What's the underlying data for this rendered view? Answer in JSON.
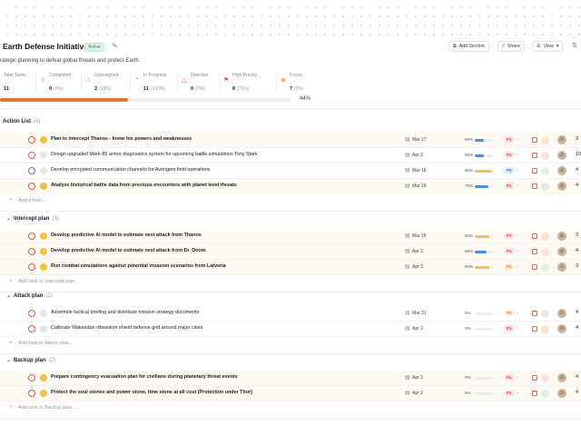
{
  "header": {
    "title": "Earth Defense Initiative",
    "status": "Active",
    "buttons": {
      "add_section": "Add Section",
      "share": "Share",
      "view": "View"
    }
  },
  "description": "rategic planning to defeat global threats and protect Earth.",
  "stats": [
    {
      "label": "Total Tasks",
      "value": "11",
      "pct": ""
    },
    {
      "label": "Completed",
      "value": "0",
      "pct": "(0%)"
    },
    {
      "label": "Unassigned",
      "value": "2",
      "pct": "(18%)"
    },
    {
      "label": "In Progress",
      "value": "11",
      "pct": "(100%)"
    },
    {
      "label": "Overdue",
      "value": "0",
      "pct": "(0%)"
    },
    {
      "label": "High Priority",
      "value": "8",
      "pct": "(73%)"
    },
    {
      "label": "Focus",
      "value": "7",
      "pct": "(0%)"
    }
  ],
  "progress": {
    "value": 44,
    "label": "44%"
  },
  "sections": [
    {
      "name": "Action List",
      "count": "(4)",
      "tasks": [
        {
          "title": "Plan to intercept Thanos - know his powers and weaknesses",
          "bold": true,
          "date": "Mar 17",
          "pct": "50%",
          "progress": 50,
          "priority": "P1",
          "num": "3"
        },
        {
          "title": "Design upgraded Mark-85 armor diagnostics system for upcoming battle simulations Tony Stark",
          "bold": false,
          "date": "Apr 2",
          "pct": "50%",
          "progress": 50,
          "priority": "P1",
          "num": "10"
        },
        {
          "title": "Develop encrypted communication channels for Avengers field operations",
          "bold": false,
          "date": "Mar 16",
          "pct": "90%",
          "progress": 90,
          "priority": "P3",
          "num": "4"
        },
        {
          "title": "Analyze historical battle data from previous encounters with planet level threats",
          "bold": true,
          "date": "Mar 19",
          "pct": "75%",
          "progress": 75,
          "priority": "P1",
          "num": "4"
        }
      ],
      "add_label": "Add a task..."
    },
    {
      "name": "Intercept plan",
      "count": "(3)",
      "tasks": [
        {
          "title": "Develop predictive AI model to estimate next attack from Thanos",
          "bold": true,
          "date": "Mar 19",
          "pct": "80%",
          "progress": 80,
          "priority": "P1",
          "num": "3"
        },
        {
          "title": "Develop predictive AI model to estimate next attack from Dr. Doom",
          "bold": true,
          "date": "Apr 2",
          "pct": "65%",
          "progress": 65,
          "priority": "P1",
          "num": "4"
        },
        {
          "title": "Run combat simulations against potential invasion scenarios from Latveria",
          "bold": true,
          "date": "Apr 3",
          "pct": "80%",
          "progress": 80,
          "priority": "P2",
          "num": "3"
        }
      ],
      "add_label": "Add task to Intercept plan..."
    },
    {
      "name": "Attack plan",
      "count": "(2)",
      "tasks": [
        {
          "title": "Assemble tactical briefing and distribute mission strategy documents",
          "bold": false,
          "date": "Mar 31",
          "pct": "0%",
          "progress": 0,
          "priority": "P2",
          "num": "4"
        },
        {
          "title": "Calibrate Wakandan vibranium shield defense grid around major cities",
          "bold": false,
          "date": "Apr 2",
          "pct": "0%",
          "progress": 0,
          "priority": "P1",
          "num": "4"
        }
      ],
      "add_label": "Add task to Attack plan..."
    },
    {
      "name": "Backup plan",
      "count": "(2)",
      "tasks": [
        {
          "title": "Prepare contingency evacuation plan for civilians during planetary threat events",
          "bold": true,
          "date": "Apr 3",
          "pct": "0%",
          "progress": 0,
          "priority": "P1",
          "num": "4"
        },
        {
          "title": "Protect the soul stones and power stone, time stone at all cost (Protection under Thor)",
          "bold": true,
          "date": "Apr 2",
          "pct": "0%",
          "progress": 0,
          "priority": "P1",
          "num": "4"
        }
      ],
      "add_label": "Add task to Backup plan..."
    }
  ]
}
